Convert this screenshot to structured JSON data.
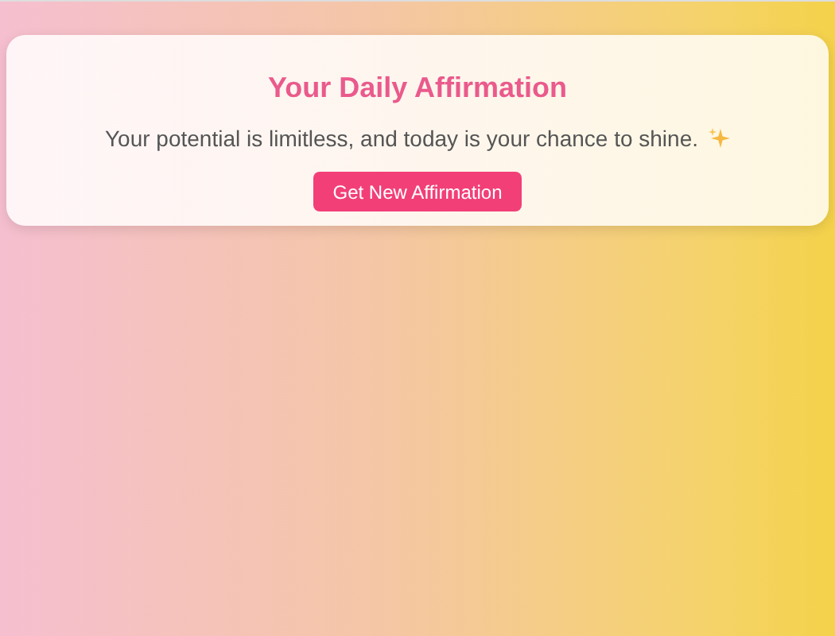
{
  "card": {
    "title": "Your Daily Affirmation",
    "affirmation": "Your potential is limitless, and today is your chance to shine.",
    "button": "Get New Affirmation"
  }
}
